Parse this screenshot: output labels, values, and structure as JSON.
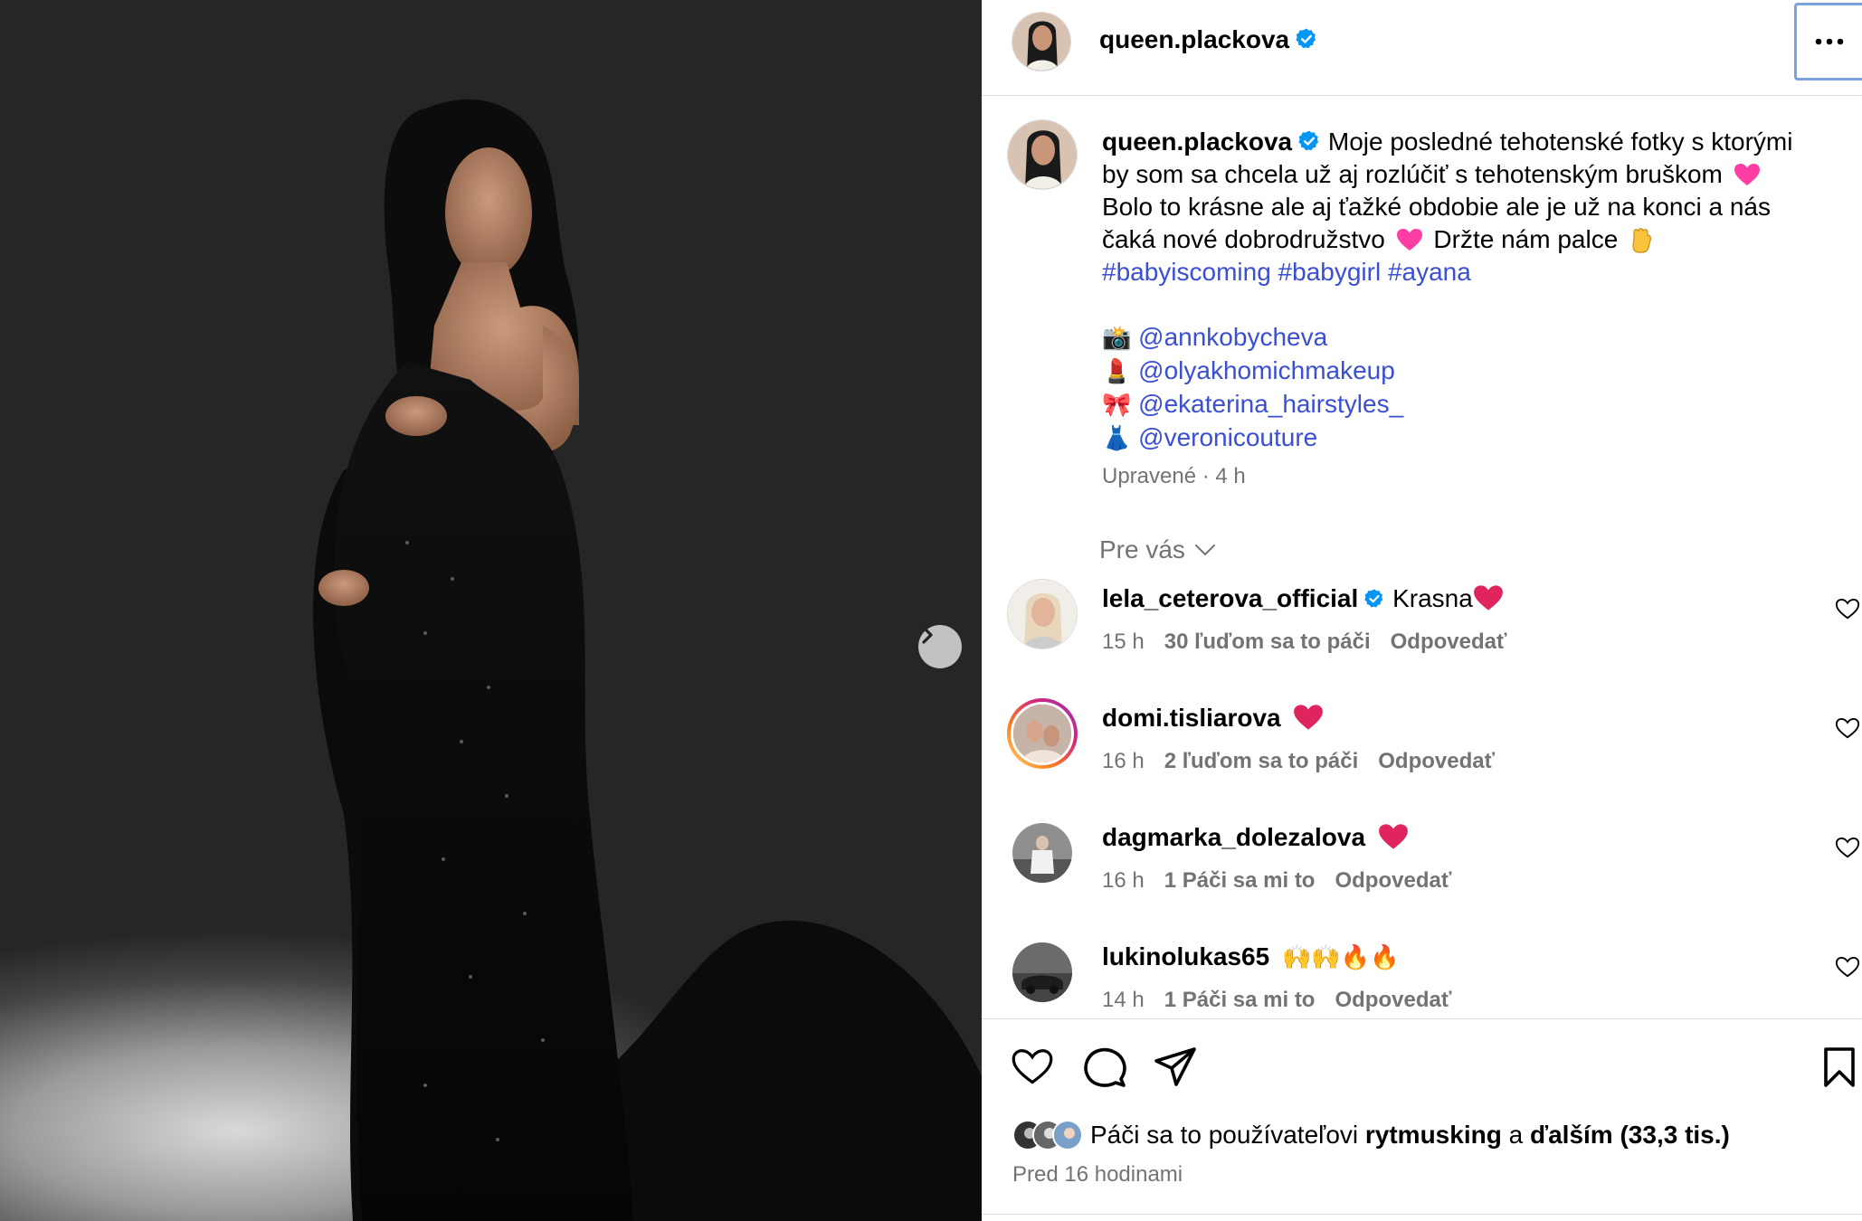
{
  "post": {
    "username": "queen.plackova",
    "caption_lines": [
      "Moje posledné tehotenské fotky s ktorými",
      "by som sa chcela už aj rozlúčiť s tehotenským bruškom",
      "Bolo to krásne ale aj ťažké obdobie ale je už na konci a nás",
      "čaká nové dobrodružstvo",
      "Držte nám palce"
    ],
    "hashtags": "#babyiscoming #babygirl #ayana",
    "credits": [
      {
        "icon": "camera-icon",
        "emoji": "📸",
        "handle": "@annkobycheva"
      },
      {
        "icon": "lipstick-icon",
        "emoji": "💄",
        "handle": "@olyakhomichmakeup"
      },
      {
        "icon": "ribbon-icon",
        "emoji": "🎀",
        "handle": "@ekaterina_hairstyles_"
      },
      {
        "icon": "dress-icon",
        "emoji": "👗",
        "handle": "@veronicouture"
      }
    ],
    "meta": "Upravené · 4 h",
    "for_you": "Pre vás",
    "likes_prefix": "Páči sa to používateľovi",
    "likes_user": "rytmusking",
    "likes_and": "a",
    "likes_rest": "ďalším (33,3 tis.)",
    "posted": "Pred 16 hodinami"
  },
  "comments": [
    {
      "username": "lela_ceterova_official",
      "verified": true,
      "text": "Krasna",
      "emoji": "❤️",
      "time": "15 h",
      "likes": "30 ľuďom sa to páči",
      "reply": "Odpovedať"
    },
    {
      "username": "domi.tisliarova",
      "verified": false,
      "text": "",
      "emoji": "❤️",
      "time": "16 h",
      "likes": "2 ľuďom sa to páči",
      "reply": "Odpovedať"
    },
    {
      "username": "dagmarka_dolezalova",
      "verified": false,
      "text": "",
      "emoji": "❤️",
      "time": "16 h",
      "likes": "1 Páči sa mi to",
      "reply": "Odpovedať"
    },
    {
      "username": "lukinolukas65",
      "verified": false,
      "text": "",
      "emoji": "🙌🙌🔥🔥",
      "time": "14 h",
      "likes": "1 Páči sa mi to",
      "reply": "Odpovedať"
    }
  ],
  "colors": {
    "link": "#3a4fd1",
    "verified": "#0095f6",
    "muted": "#737373",
    "heart": "#e0245e",
    "pink_heart": "#ff3ea5"
  }
}
